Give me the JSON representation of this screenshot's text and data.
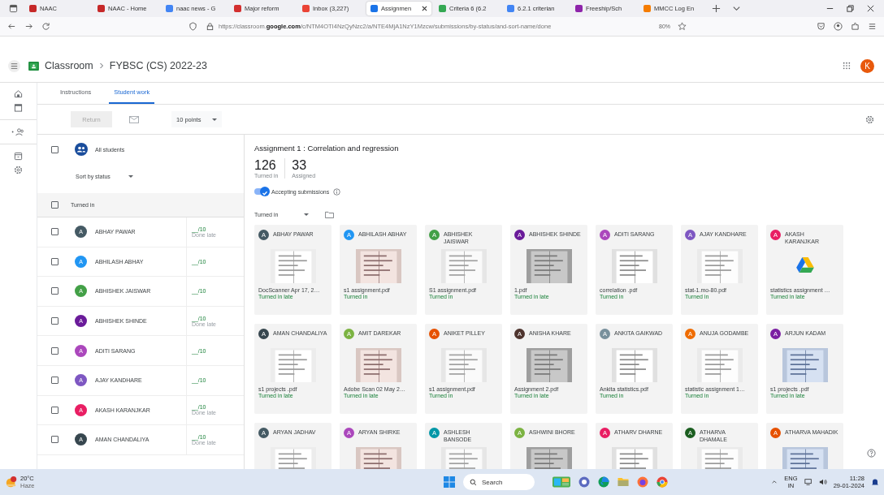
{
  "browser": {
    "tabs": [
      {
        "title": "NAAC",
        "selected": false
      },
      {
        "title": "NAAC - Home",
        "selected": false
      },
      {
        "title": "naac news - G",
        "selected": false
      },
      {
        "title": "Major reform",
        "selected": false
      },
      {
        "title": "Inbox (3,227)",
        "selected": false
      },
      {
        "title": "Assignmen",
        "selected": true
      },
      {
        "title": "Criteria 6 (6.2",
        "selected": false
      },
      {
        "title": "6.2.1 criterian",
        "selected": false
      },
      {
        "title": "Freeship/Sch",
        "selected": false
      },
      {
        "title": "MMCC Log En",
        "selected": false
      }
    ],
    "url": "https://classroom.**google.com**/c/NTM4OTI4NzQyNzc2/a/NTE4MjA1NzY1Mzcw/submissions/by-status/and-sort-name/done",
    "zoom": "80%"
  },
  "header": {
    "breadcrumb": [
      "Classroom",
      "FYBSC (CS) 2022-23"
    ],
    "avatar": "K"
  },
  "tabs": [
    {
      "label": "Instructions",
      "selected": false
    },
    {
      "label": "Student work",
      "selected": true
    }
  ],
  "toolbar": {
    "return_button": "Return",
    "points": "10 points"
  },
  "students": {
    "all_label": "All students",
    "all_checked": false,
    "sort": "Sort by status",
    "group": "Turned in",
    "group_checked": false,
    "items": [
      {
        "initial": "A",
        "name": "ABHAY PAWAR",
        "color": "#455a64",
        "grade": "__/10",
        "status": "Done late",
        "checked": false
      },
      {
        "initial": "A",
        "name": "ABHILASH ABHAY",
        "color": "#2196f3",
        "grade": "__/10",
        "checked": false
      },
      {
        "initial": "A",
        "name": "ABHISHEK JAISWAR",
        "color": "#43a047",
        "grade": "__/10",
        "checked": false
      },
      {
        "initial": "A",
        "name": "ABHISHEK SHINDE",
        "color": "#6a1b9a",
        "grade": "__/10",
        "status": "Done late",
        "checked": false
      },
      {
        "initial": "A",
        "name": "ADITI SARANG",
        "color": "#ab47bc",
        "grade": "__/10",
        "checked": false
      },
      {
        "initial": "A",
        "name": "AJAY KANDHARE",
        "color": "#7e57c2",
        "grade": "__/10",
        "checked": false
      },
      {
        "initial": "A",
        "name": "AKASH KARANJKAR",
        "color": "#e91e63",
        "grade": "__/10",
        "status": "Done late",
        "checked": false
      },
      {
        "initial": "A",
        "name": "AMAN CHANDALIYA",
        "color": "#37474f",
        "grade": "__/10",
        "status": "Done late",
        "checked": false
      }
    ]
  },
  "submissions": {
    "title": "Assignment 1 : Correlation and regression",
    "stats": [
      {
        "value": "126",
        "label": "Turned in"
      },
      {
        "value": "33",
        "label": "Assigned"
      }
    ],
    "accepting": {
      "label": "Accepting submissions",
      "on": true
    },
    "filter": "Turned in",
    "cards": [
      {
        "initial": "A",
        "name": "ABHAY PAWAR",
        "color": "#455a64",
        "kind": "picture",
        "file": "DocScanner Apr 17, 2…",
        "status": "Turned in late"
      },
      {
        "initial": "A",
        "name": "ABHILASH ABHAY",
        "color": "#2196f3",
        "kind": "picture",
        "file": "s1 assignment.pdf",
        "status": "Turned in"
      },
      {
        "initial": "A",
        "name": "ABHISHEK JAISWAR",
        "color": "#43a047",
        "kind": "picture",
        "file": "S1 assignment.pdf",
        "status": "Turned in"
      },
      {
        "initial": "A",
        "name": "ABHISHEK SHINDE",
        "color": "#6a1b9a",
        "kind": "picture",
        "file": "1.pdf",
        "status": "Turned in late"
      },
      {
        "initial": "A",
        "name": "ADITI SARANG",
        "color": "#ab47bc",
        "kind": "picture",
        "file": "correlation .pdf",
        "status": "Turned in"
      },
      {
        "initial": "A",
        "name": "AJAY KANDHARE",
        "color": "#7e57c2",
        "kind": "picture",
        "file": "stat-1.mo-80.pdf",
        "status": "Turned in"
      },
      {
        "initial": "A",
        "name": "AKASH KARANJKAR",
        "color": "#e91e63",
        "kind": "drive",
        "file": "statistics assignment …",
        "status": "Turned in late"
      },
      {
        "initial": "A",
        "name": "AMAN CHANDALIYA",
        "color": "#37474f",
        "kind": "picture",
        "file": "s1 projects .pdf",
        "status": "Turned in late"
      },
      {
        "initial": "A",
        "name": "AMIT DAREKAR",
        "color": "#7cb342",
        "kind": "picture",
        "file": "Adobe Scan 02 May 2…",
        "status": "Turned in late"
      },
      {
        "initial": "A",
        "name": "ANIKET PILLEY",
        "color": "#e65100",
        "kind": "picture",
        "file": "s1 assignment.pdf",
        "status": "Turned in"
      },
      {
        "initial": "A",
        "name": "ANISHA KHARE",
        "color": "#4e342e",
        "kind": "picture",
        "file": "Assignment 2.pdf",
        "status": "Turned in late"
      },
      {
        "initial": "A",
        "name": "ANKITA GAIKWAD",
        "color": "#78909c",
        "kind": "picture",
        "file": "Ankita statistics.pdf",
        "status": "Turned in"
      },
      {
        "initial": "A",
        "name": "ANUJA GODAMBE",
        "color": "#ef6c00",
        "kind": "picture",
        "file": "statistic assignment 1…",
        "status": "Turned in"
      },
      {
        "initial": "A",
        "name": "ARJUN KADAM",
        "color": "#7b1fa2",
        "kind": "picture",
        "file": "s1 projects .pdf",
        "status": "Turned in late"
      },
      {
        "initial": "A",
        "name": "ARYAN JADHAV",
        "color": "#455a64",
        "kind": "picture"
      },
      {
        "initial": "A",
        "name": "ARYAN SHIRKE",
        "color": "#ab47bc",
        "kind": "picture"
      },
      {
        "initial": "A",
        "name": "ASHLESH BANSODE",
        "color": "#0097a7",
        "kind": "picture"
      },
      {
        "initial": "A",
        "name": "ASHWINI BHORE",
        "color": "#7cb342",
        "kind": "picture"
      },
      {
        "initial": "A",
        "name": "ATHARV DHARNE",
        "color": "#e91e63",
        "kind": "picture"
      },
      {
        "initial": "A",
        "name": "ATHARVA DHAMALE",
        "color": "#1b5e20",
        "kind": "picture"
      },
      {
        "initial": "A",
        "name": "ATHARVA MAHADIK",
        "color": "#e65100",
        "kind": "picture"
      }
    ]
  },
  "taskbar": {
    "temperature": "20°C",
    "weather": "Haze",
    "search": "Search",
    "language": "ENG",
    "region": "IN",
    "time": "11:28",
    "date": "29-01-2024"
  }
}
